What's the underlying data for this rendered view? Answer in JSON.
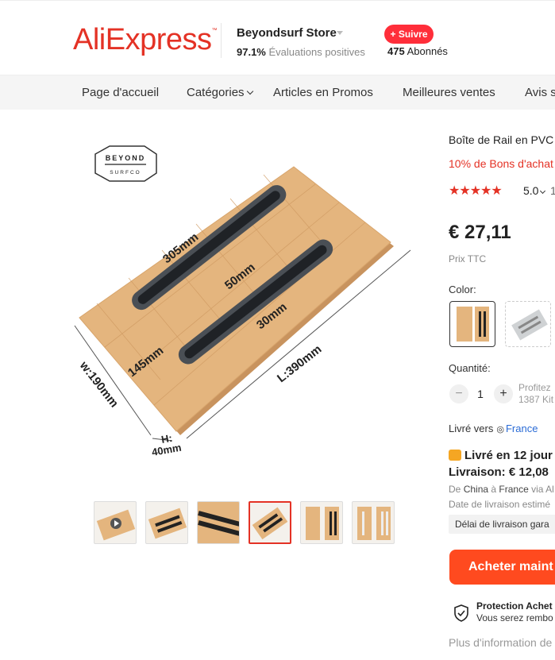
{
  "header": {
    "logo": "AliExpress",
    "store_name": "Beyondsurf Store",
    "rating_percent": "97.1%",
    "rating_text": "Évaluations positives",
    "follow_label": "+ Suivre",
    "followers_count": "475",
    "followers_label": "Abonnés"
  },
  "nav": {
    "items": [
      "Page d'accueil",
      "Catégories",
      "Articles en Promos",
      "Meilleures ventes",
      "Avis su"
    ]
  },
  "product_image": {
    "brand_line1": "BEYOND",
    "brand_line2": "SURFCO",
    "dim_length": "L:390mm",
    "dim_width": "w:190mm",
    "dim_height": "H:",
    "dim_height_val": "40mm",
    "dim_slot": "305mm",
    "dim_gap1": "50mm",
    "dim_gap2": "30mm",
    "dim_edge": "145mm"
  },
  "thumbnails": {
    "count": 6,
    "active_index": 3
  },
  "product": {
    "title": "Boîte de Rail en PVC",
    "promo": "10% de Bons d'achat",
    "rating": "5.0",
    "rating_extra": "1",
    "price": "€ 27,11",
    "price_note": "Prix TTC",
    "color_label": "Color:",
    "qty_label": "Quantité:",
    "qty_value": "1",
    "qty_minus": "−",
    "qty_plus": "+",
    "qty_note_line1": "Profitez",
    "qty_note_line2": "1387 Kit",
    "ship_to_label": "Livré vers",
    "ship_to_country": "France",
    "delivery": "Livré en 12 jour",
    "shipping_cost": "Livraison: € 12,08",
    "route_prefix": "De",
    "route_from": "China",
    "route_mid": "à",
    "route_to": "France",
    "route_suffix": "via Al",
    "date_estimate": "Date de livraison estimé",
    "guarantee": "Délai de livraison gara",
    "buy_label": "Acheter maint",
    "protection_title": "Protection Achet",
    "protection_sub": "Vous serez rembo",
    "more_info": "Plus d'information de"
  },
  "colors": {
    "accent": "#e43225",
    "follow": "#ff2e3a",
    "buy": "#ff4a1f",
    "link": "#2a6bd6",
    "board": "#e4b57e",
    "rail": "#2a2d31"
  }
}
